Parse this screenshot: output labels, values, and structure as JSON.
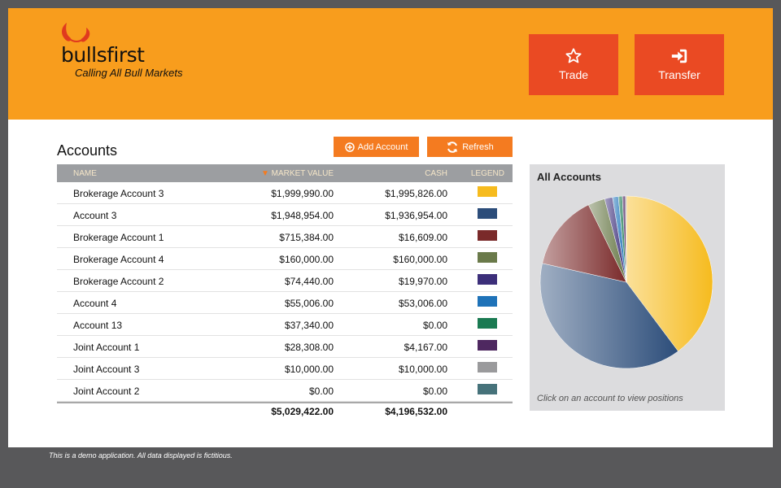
{
  "brand": {
    "name": "bullsfirst",
    "tagline": "Calling All Bull Markets"
  },
  "header": {
    "trade_label": "Trade",
    "transfer_label": "Transfer"
  },
  "accounts": {
    "title": "Accounts",
    "add_label": "Add Account",
    "refresh_label": "Refresh",
    "columns": {
      "name": "NAME",
      "market_value": "MARKET VALUE",
      "cash": "CASH",
      "legend": "LEGEND"
    },
    "sort_indicator": "▼",
    "rows": [
      {
        "name": "Brokerage Account 3",
        "market_value": "$1,999,990.00",
        "cash": "$1,995,826.00",
        "color": "#f6bb1e"
      },
      {
        "name": "Account 3",
        "market_value": "$1,948,954.00",
        "cash": "$1,936,954.00",
        "color": "#2c4d7a"
      },
      {
        "name": "Brokerage Account 1",
        "market_value": "$715,384.00",
        "cash": "$16,609.00",
        "color": "#7a2a2a"
      },
      {
        "name": "Brokerage Account 4",
        "market_value": "$160,000.00",
        "cash": "$160,000.00",
        "color": "#6a7a4a"
      },
      {
        "name": "Brokerage Account 2",
        "market_value": "$74,440.00",
        "cash": "$19,970.00",
        "color": "#3c2f7a"
      },
      {
        "name": "Account 4",
        "market_value": "$55,006.00",
        "cash": "$53,006.00",
        "color": "#1e72b8"
      },
      {
        "name": "Account 13",
        "market_value": "$37,340.00",
        "cash": "$0.00",
        "color": "#1a7a52"
      },
      {
        "name": "Joint Account 1",
        "market_value": "$28,308.00",
        "cash": "$4,167.00",
        "color": "#4e2860"
      },
      {
        "name": "Joint Account 3",
        "market_value": "$10,000.00",
        "cash": "$10,000.00",
        "color": "#9a9a9c"
      },
      {
        "name": "Joint Account 2",
        "market_value": "$0.00",
        "cash": "$0.00",
        "color": "#46727a"
      }
    ],
    "totals": {
      "market_value": "$5,029,422.00",
      "cash": "$4,196,532.00"
    }
  },
  "chart": {
    "title": "All Accounts",
    "note": "Click on an account to view positions"
  },
  "chart_data": {
    "type": "pie",
    "title": "All Accounts",
    "labels": [
      "Brokerage Account 3",
      "Account 3",
      "Brokerage Account 1",
      "Brokerage Account 4",
      "Brokerage Account 2",
      "Account 4",
      "Account 13",
      "Joint Account 1",
      "Joint Account 3",
      "Joint Account 2"
    ],
    "values": [
      1999990,
      1948954,
      715384,
      160000,
      74440,
      55006,
      37340,
      28308,
      10000,
      0
    ]
  },
  "footer": {
    "text": "This is a demo application. All data displayed is fictitious."
  }
}
